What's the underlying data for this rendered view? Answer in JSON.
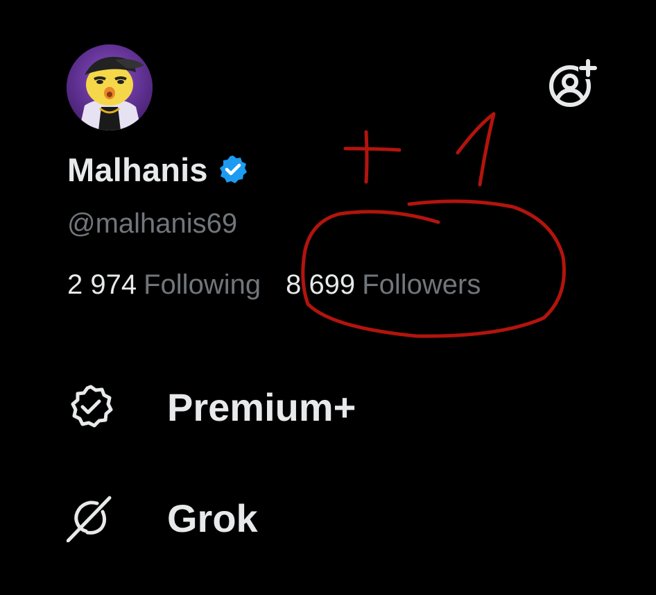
{
  "profile": {
    "display_name": "Malhanis",
    "handle": "@malhanis69",
    "verified": true,
    "verified_color": "#1d9bf0"
  },
  "stats": {
    "following_count": "2 974",
    "following_label": "Following",
    "followers_count": "8 699",
    "followers_label": "Followers"
  },
  "menu": {
    "items": [
      {
        "label": "Premium+",
        "icon": "verified-badge-outline-icon"
      },
      {
        "label": "Grok",
        "icon": "grok-icon"
      }
    ]
  },
  "header": {
    "add_account_icon": "add-account-icon"
  },
  "annotation": {
    "color": "#b3140e",
    "icon": "plus-one-scribble"
  },
  "colors": {
    "background": "#000000",
    "primary_text": "#e7e9ea",
    "secondary_text": "#71767b"
  }
}
